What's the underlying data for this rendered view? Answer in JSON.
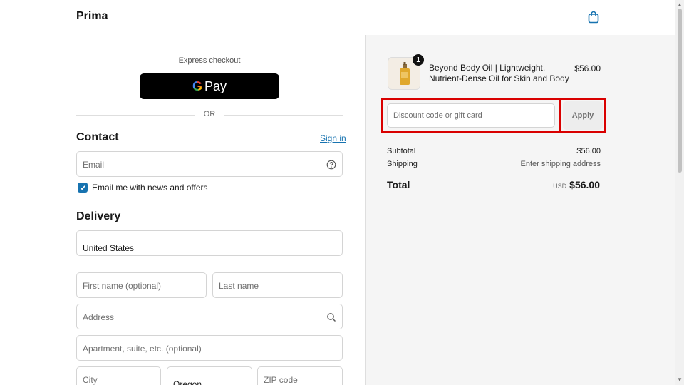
{
  "header": {
    "logo": "Prima",
    "cart_icon": "bag-icon"
  },
  "express": {
    "label": "Express checkout",
    "gpay_text": "Pay",
    "gpay_g": "G",
    "or": "OR"
  },
  "contact": {
    "title": "Contact",
    "signin": "Sign in",
    "email_placeholder": "Email",
    "newsletter_label": "Email me with news and offers",
    "newsletter_checked": true
  },
  "delivery": {
    "title": "Delivery",
    "country": "United States",
    "first_name_placeholder": "First name (optional)",
    "last_name_placeholder": "Last name",
    "address_placeholder": "Address",
    "apartment_placeholder": "Apartment, suite, etc. (optional)",
    "city_placeholder": "City",
    "state_value": "Oregon",
    "zip_placeholder": "ZIP code"
  },
  "summary": {
    "item": {
      "name": "Beyond Body Oil | Lightweight, Nutrient-Dense Oil for Skin and Body",
      "price": "$56.00",
      "quantity": "1"
    },
    "discount_placeholder": "Discount code or gift card",
    "apply_label": "Apply",
    "subtotal_label": "Subtotal",
    "subtotal_value": "$56.00",
    "shipping_label": "Shipping",
    "shipping_value": "Enter shipping address",
    "total_label": "Total",
    "total_currency": "USD",
    "total_value": "$56.00"
  },
  "colors": {
    "accent": "#1773b0",
    "highlight": "#d90000",
    "summary_bg": "#f5f5f5"
  }
}
